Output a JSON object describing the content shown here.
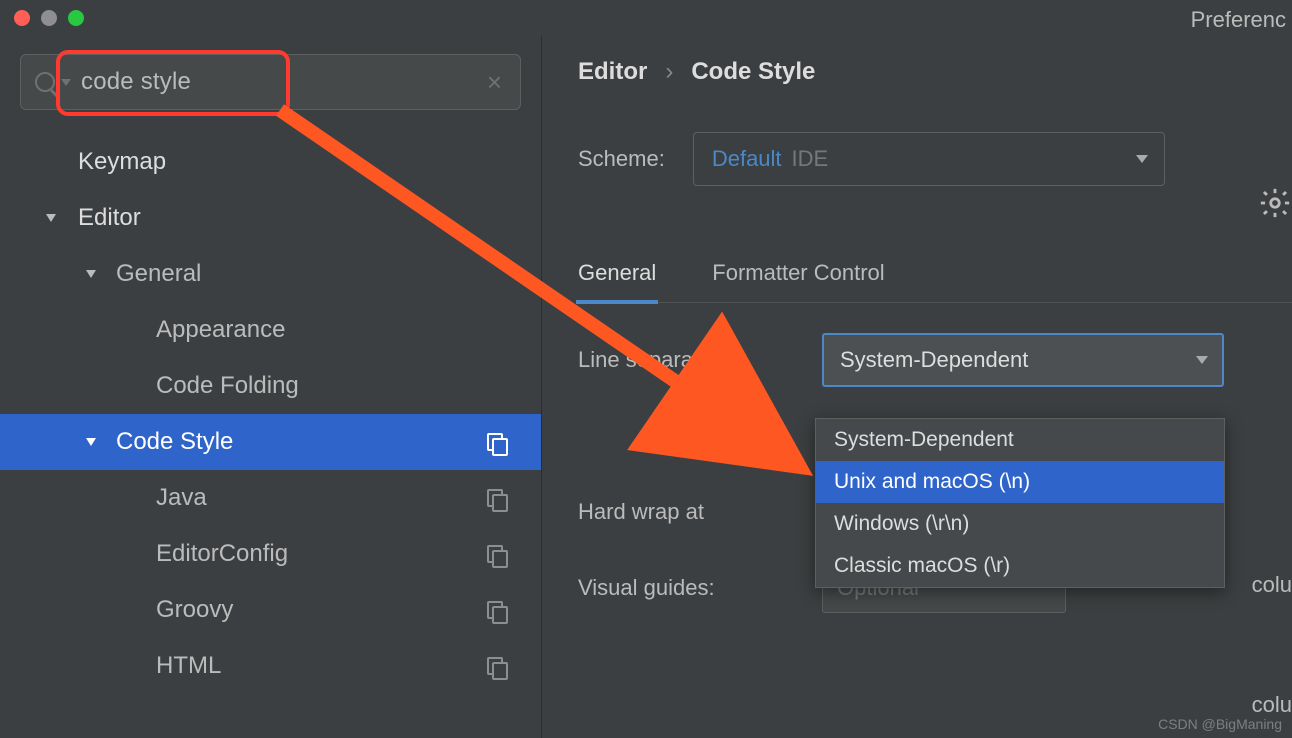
{
  "window": {
    "title": "Preferenc"
  },
  "search": {
    "value": "code style"
  },
  "sidebar": {
    "items": [
      {
        "label": "Keymap",
        "level": "lvl0",
        "expandable": false,
        "copy": false
      },
      {
        "label": "Editor",
        "level": "lvlEditor",
        "expandable": true,
        "copy": false
      },
      {
        "label": "General",
        "level": "lvl1",
        "expandable": true,
        "copy": false
      },
      {
        "label": "Appearance",
        "level": "lvl2",
        "expandable": false,
        "copy": false
      },
      {
        "label": "Code Folding",
        "level": "lvl2",
        "expandable": false,
        "copy": false
      },
      {
        "label": "Code Style",
        "level": "lvl1",
        "expandable": true,
        "copy": true,
        "selected": true
      },
      {
        "label": "Java",
        "level": "lvl2",
        "expandable": false,
        "copy": true
      },
      {
        "label": "EditorConfig",
        "level": "lvl2",
        "expandable": false,
        "copy": true
      },
      {
        "label": "Groovy",
        "level": "lvl2",
        "expandable": false,
        "copy": true
      },
      {
        "label": "HTML",
        "level": "lvl2",
        "expandable": false,
        "copy": true
      }
    ]
  },
  "breadcrumb": {
    "parent": "Editor",
    "sep": "›",
    "current": "Code Style"
  },
  "scheme": {
    "label": "Scheme:",
    "value": "Default",
    "tag": "IDE"
  },
  "tabs": [
    {
      "label": "General",
      "active": true
    },
    {
      "label": "Formatter Control",
      "active": false
    }
  ],
  "form": {
    "line_sep_label": "Line separator:",
    "line_sep_value": "System-Dependent",
    "hard_wrap_label": "Hard wrap at",
    "hard_wrap_suffix": "colu",
    "visual_guides_label": "Visual guides:",
    "visual_guides_placeholder": "Optional",
    "visual_guides_suffix": "colu"
  },
  "dropdown": {
    "options": [
      "System-Dependent",
      "Unix and macOS (\\n)",
      "Windows (\\r\\n)",
      "Classic macOS (\\r)"
    ],
    "selected_index": 1
  },
  "watermark": "CSDN @BigManing"
}
